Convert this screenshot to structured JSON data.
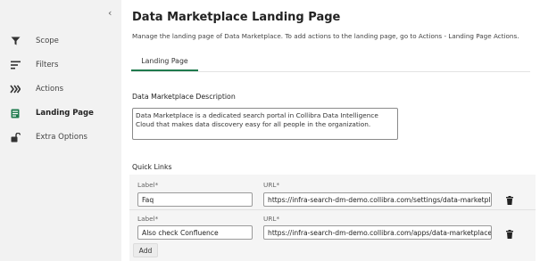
{
  "sidebar": {
    "collapse_icon": "chevron-left-icon",
    "items": [
      {
        "label": "Scope",
        "icon": "funnel-icon",
        "active": false
      },
      {
        "label": "Filters",
        "icon": "filter-lines-icon",
        "active": false
      },
      {
        "label": "Actions",
        "icon": "chevrons-right-icon",
        "active": false
      },
      {
        "label": "Landing Page",
        "icon": "landing-page-icon",
        "active": true
      },
      {
        "label": "Extra Options",
        "icon": "unlock-icon",
        "active": false
      }
    ]
  },
  "main": {
    "title": "Data Marketplace Landing Page",
    "subtitle": "Manage the landing page of Data Marketplace. To add actions to the landing page, go to Actions - Landing Page Actions.",
    "tabs": [
      {
        "label": "Landing Page",
        "active": true
      }
    ],
    "description_heading": "Data Marketplace Description",
    "description_text": "Data Marketplace is a dedicated search portal in Collibra Data Intelligence Cloud that makes data discovery easy for all people in the organization.",
    "quick_links_heading": "Quick Links",
    "quick_links": [
      {
        "label_caption": "Label*",
        "label_value": "Faq",
        "url_caption": "URL*",
        "url_value": "https://infra-search-dm-demo.collibra.com/settings/data-marketplace"
      },
      {
        "label_caption": "Label*",
        "label_value": "Also check Confluence",
        "url_caption": "URL*",
        "url_value": "https://infra-search-dm-demo.collibra.com/apps/data-marketplace"
      }
    ],
    "add_label": "Add"
  },
  "colors": {
    "accent": "#1f7a4d",
    "sidebar_bg": "#f2f2f2",
    "panel_bg": "#f5f5f5"
  }
}
